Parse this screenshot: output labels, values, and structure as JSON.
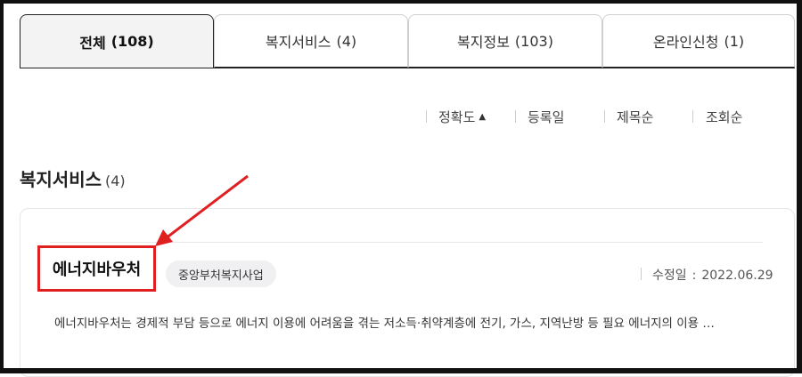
{
  "tabs": [
    {
      "label": "전체",
      "count": "(108)",
      "active": true
    },
    {
      "label": "복지서비스",
      "count": "(4)",
      "active": false
    },
    {
      "label": "복지정보",
      "count": "(103)",
      "active": false
    },
    {
      "label": "온라인신청",
      "count": "(1)",
      "active": false
    }
  ],
  "sort": {
    "accuracy": "정확도",
    "accuracy_arrow": "▲",
    "registered": "등록일",
    "title": "제목순",
    "views": "조회순"
  },
  "section": {
    "title": "복지서비스",
    "count": "(4)"
  },
  "result": {
    "title": "에너지바우처",
    "badge": "중앙부처복지사업",
    "modified_label": "수정일",
    "modified_colon": ":",
    "modified_date": "2022.06.29",
    "description": "에너지바우처는 경제적 부담 등으로 에너지 이용에 어려움을 겪는 저소득·취약계층에 전기, 가스, 지역난방 등 필요 에너지의 이용 …"
  },
  "colors": {
    "highlight": "#e02020",
    "active_tab_bg": "#f3f3f3"
  },
  "icons": {
    "sort_arrow": "triangle-up-icon",
    "annotation": "red-arrow-icon"
  }
}
